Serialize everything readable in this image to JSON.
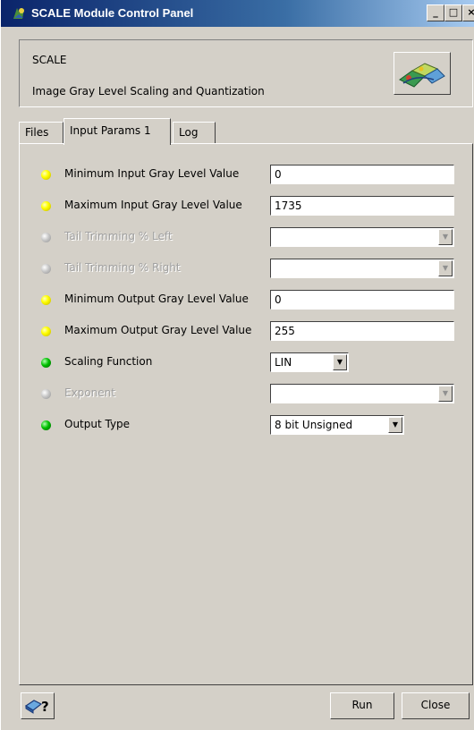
{
  "window": {
    "title": "SCALE Module Control Panel",
    "controls": {
      "minimize": "_",
      "maximize": "□",
      "close": "×"
    }
  },
  "header": {
    "module_name": "SCALE",
    "description": "Image Gray Level Scaling and Quantization",
    "logo_icon": "satellite-map-icon"
  },
  "tabs": [
    {
      "label": "Files",
      "active": false
    },
    {
      "label": "Input Params 1",
      "active": true
    },
    {
      "label": "Log",
      "active": false
    }
  ],
  "params": [
    {
      "label": "Minimum Input Gray Level Value",
      "status": "yellow",
      "enabled": true,
      "type": "text",
      "value": "0"
    },
    {
      "label": "Maximum Input Gray Level Value",
      "status": "yellow",
      "enabled": true,
      "type": "text",
      "value": "1735"
    },
    {
      "label": "Tail Trimming % Left",
      "status": "grey",
      "enabled": false,
      "type": "combo",
      "value": ""
    },
    {
      "label": "Tail Trimming % Right",
      "status": "grey",
      "enabled": false,
      "type": "combo",
      "value": ""
    },
    {
      "label": "Minimum Output Gray Level Value",
      "status": "yellow",
      "enabled": true,
      "type": "text",
      "value": "0"
    },
    {
      "label": "Maximum Output Gray Level Value",
      "status": "yellow",
      "enabled": true,
      "type": "text",
      "value": "255"
    },
    {
      "label": "Scaling Function",
      "status": "green",
      "enabled": true,
      "type": "combo",
      "value": "LIN"
    },
    {
      "label": "Exponent",
      "status": "grey",
      "enabled": false,
      "type": "combo",
      "value": ""
    },
    {
      "label": "Output Type",
      "status": "green",
      "enabled": true,
      "type": "combo",
      "value": "8 bit Unsigned"
    }
  ],
  "status_colors": {
    "yellow": "#ffff00",
    "green": "#00c000",
    "grey": "#c8c8c8"
  },
  "footer": {
    "help_icon": "help-question-icon",
    "run_label": "Run",
    "close_label": "Close"
  }
}
